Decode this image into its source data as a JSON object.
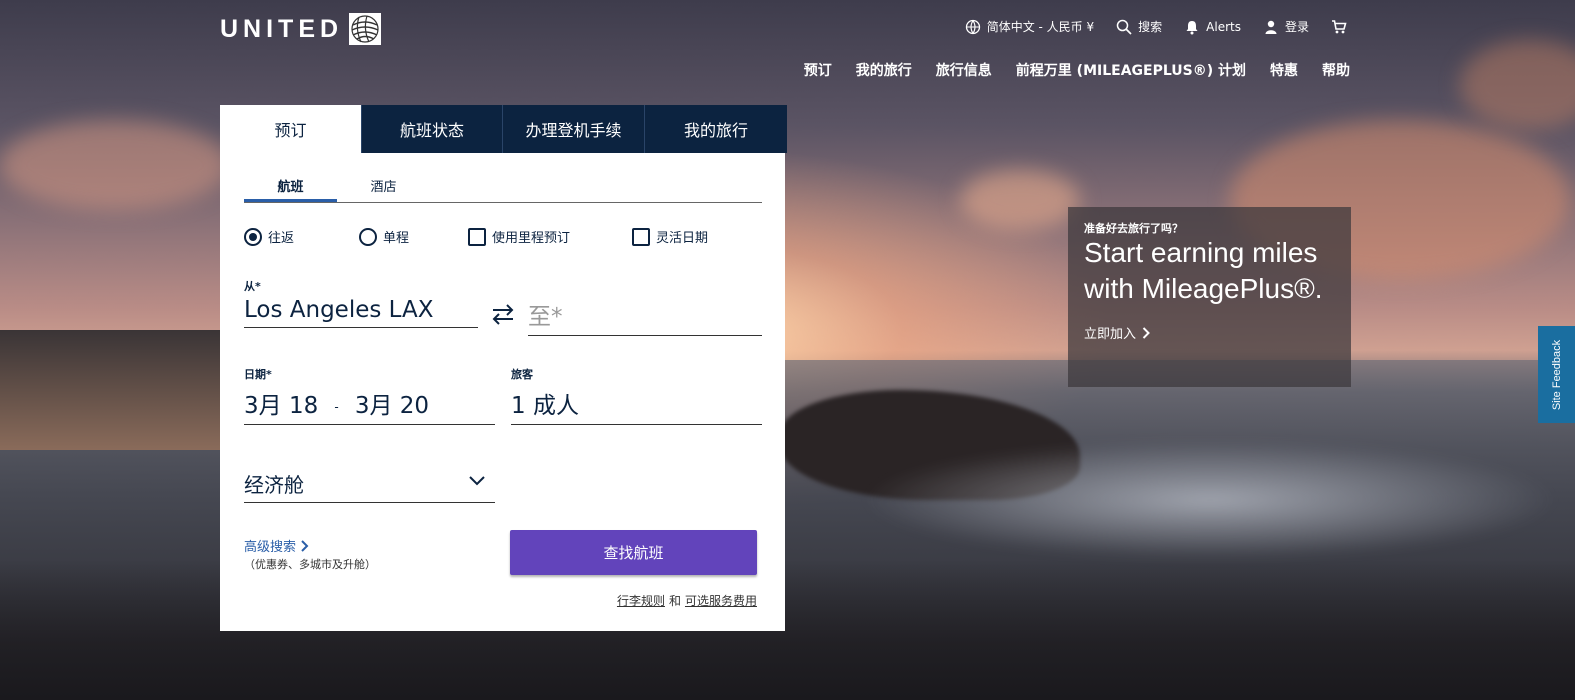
{
  "header": {
    "logo_text": "UNITED",
    "utility": {
      "language": "简体中文 - 人民币 ¥",
      "search": "搜索",
      "alerts": "Alerts",
      "login": "登录"
    },
    "nav": [
      "预订",
      "我的旅行",
      "旅行信息",
      "前程万里 (MILEAGEPLUS®) 计划",
      "特惠",
      "帮助"
    ]
  },
  "booking": {
    "tabs": [
      "预订",
      "航班状态",
      "办理登机手续",
      "我的旅行"
    ],
    "subtabs": [
      "航班",
      "酒店"
    ],
    "options": {
      "roundtrip": "往返",
      "oneway": "单程",
      "use_miles": "使用里程预订",
      "flexible_dates": "灵活日期"
    },
    "from_label": "从*",
    "from_value": "Los Angeles LAX",
    "to_placeholder": "至*",
    "date_label": "日期*",
    "date_start": "3月 18",
    "date_separator": "-",
    "date_end": "3月 20",
    "travelers_label": "旅客",
    "travelers_value": "1 成人",
    "cabin_value": "经济舱",
    "advanced_search": "高级搜索",
    "advanced_search_sub": "（优惠券、多城市及升舱）",
    "search_button": "查找航班",
    "bag_rules": "行李规则",
    "and_text": "和",
    "optional_fees": "可选服务费用"
  },
  "promo": {
    "kicker": "准备好去旅行了吗？",
    "headline": "Start earning miles with MileagePlus®.",
    "link": "立即加入"
  },
  "feedback": {
    "label": "Site Feedback"
  },
  "colors": {
    "navy": "#0c2340",
    "purple_button": "#6244bb",
    "link_blue": "#2a5ea8",
    "feedback_blue": "#1a6ea0"
  }
}
